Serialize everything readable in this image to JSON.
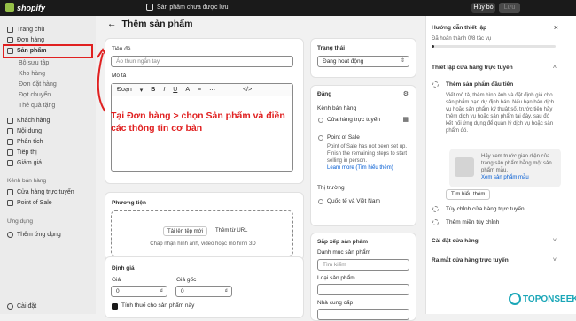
{
  "topbar": {
    "logo": "shopify",
    "unsaved": "Sản phẩm chưa được lưu",
    "discard": "Hủy bỏ",
    "save": "Lưu"
  },
  "sidebar": {
    "home": "Trang chủ",
    "orders": "Đơn hàng",
    "products": "Sản phẩm",
    "collections": "Bộ sưu tập",
    "inventory": "Kho hàng",
    "purchase_orders": "Đơn đặt hàng",
    "transfers": "Đợt chuyển",
    "gift_cards": "Thẻ quà tặng",
    "customers": "Khách hàng",
    "content": "Nội dung",
    "analytics": "Phân tích",
    "marketing": "Tiếp thị",
    "discounts": "Giảm giá",
    "sales_channels_heading": "Kênh bán hàng",
    "online_store": "Cửa hàng trực tuyến",
    "pos": "Point of Sale",
    "apps_heading": "Ứng dụng",
    "add_apps": "Thêm ứng dụng",
    "settings": "Cài đặt"
  },
  "main": {
    "title": "Thêm sản phẩm",
    "title_label": "Tiêu đề",
    "title_placeholder": "Áo thun ngắn tay",
    "desc_label": "Mô tả",
    "format": "Đoạn",
    "annotation": "Tại Đơn hàng > chọn Sản phẩm và điền các thông tin cơ bản",
    "media_label": "Phương tiện",
    "upload_new": "Tải lên tệp mới",
    "add_url": "Thêm từ URL",
    "media_hint": "Chấp nhận hình ảnh, video hoặc mô hình 3D",
    "pricing_label": "Định giá",
    "price_label": "Giá",
    "compare_label": "Giá gốc",
    "price_value": "0",
    "compare_value": "0",
    "currency": "₫",
    "tax_label": "Tính thuế cho sản phẩm này"
  },
  "right": {
    "status_label": "Trạng thái",
    "status_value": "Đang hoạt động",
    "publishing_label": "Đăng",
    "sales_channels": "Kênh bán hàng",
    "online_store": "Cửa hàng trực tuyến",
    "pos": "Point of Sale",
    "pos_note": "Point of Sale has not been set up. Finish the remaining steps to start selling in person.",
    "pos_link": "Learn more (Tìm hiểu thêm)",
    "markets_label": "Thị trường",
    "markets_value": "Quốc tế và Việt Nam",
    "org_label": "Sắp xếp sản phẩm",
    "category_label": "Danh mục sản phẩm",
    "search_placeholder": "Tìm kiếm",
    "type_label": "Loại sản phẩm",
    "vendor_label": "Nhà cung cấp"
  },
  "guide": {
    "title": "Hướng dẫn thiết lập",
    "progress": "Đã hoàn thành 0/8 tác vụ",
    "progress_fraction": 0,
    "section1": "Thiết lập cửa hàng trực tuyến",
    "task1_title": "Thêm sản phẩm đầu tiên",
    "task1_desc": "Viết mô tả, thêm hình ảnh và đặt định giá cho sản phẩm bạn dự định bán. Nếu bạn bán dịch vụ hoặc sản phẩm kỹ thuật số, trước tiên hãy thêm dịch vụ hoặc sản phẩm tại đây, sau đó kết nối ứng dụng để quản lý dịch vụ hoặc sản phẩm đó.",
    "promo_text": "Hãy xem trước giao diện của trang sản phẩm bằng một sản phẩm mẫu.",
    "promo_link": "Xem sản phẩm mẫu",
    "learn_more": "Tìm hiểu thêm",
    "task2": "Tùy chỉnh cửa hàng trực tuyến",
    "task3": "Thêm miền tùy chỉnh",
    "section2": "Cài đặt cửa hàng",
    "section3": "Ra mắt cửa hàng trực tuyến"
  },
  "watermark": "TOPONSEEK"
}
